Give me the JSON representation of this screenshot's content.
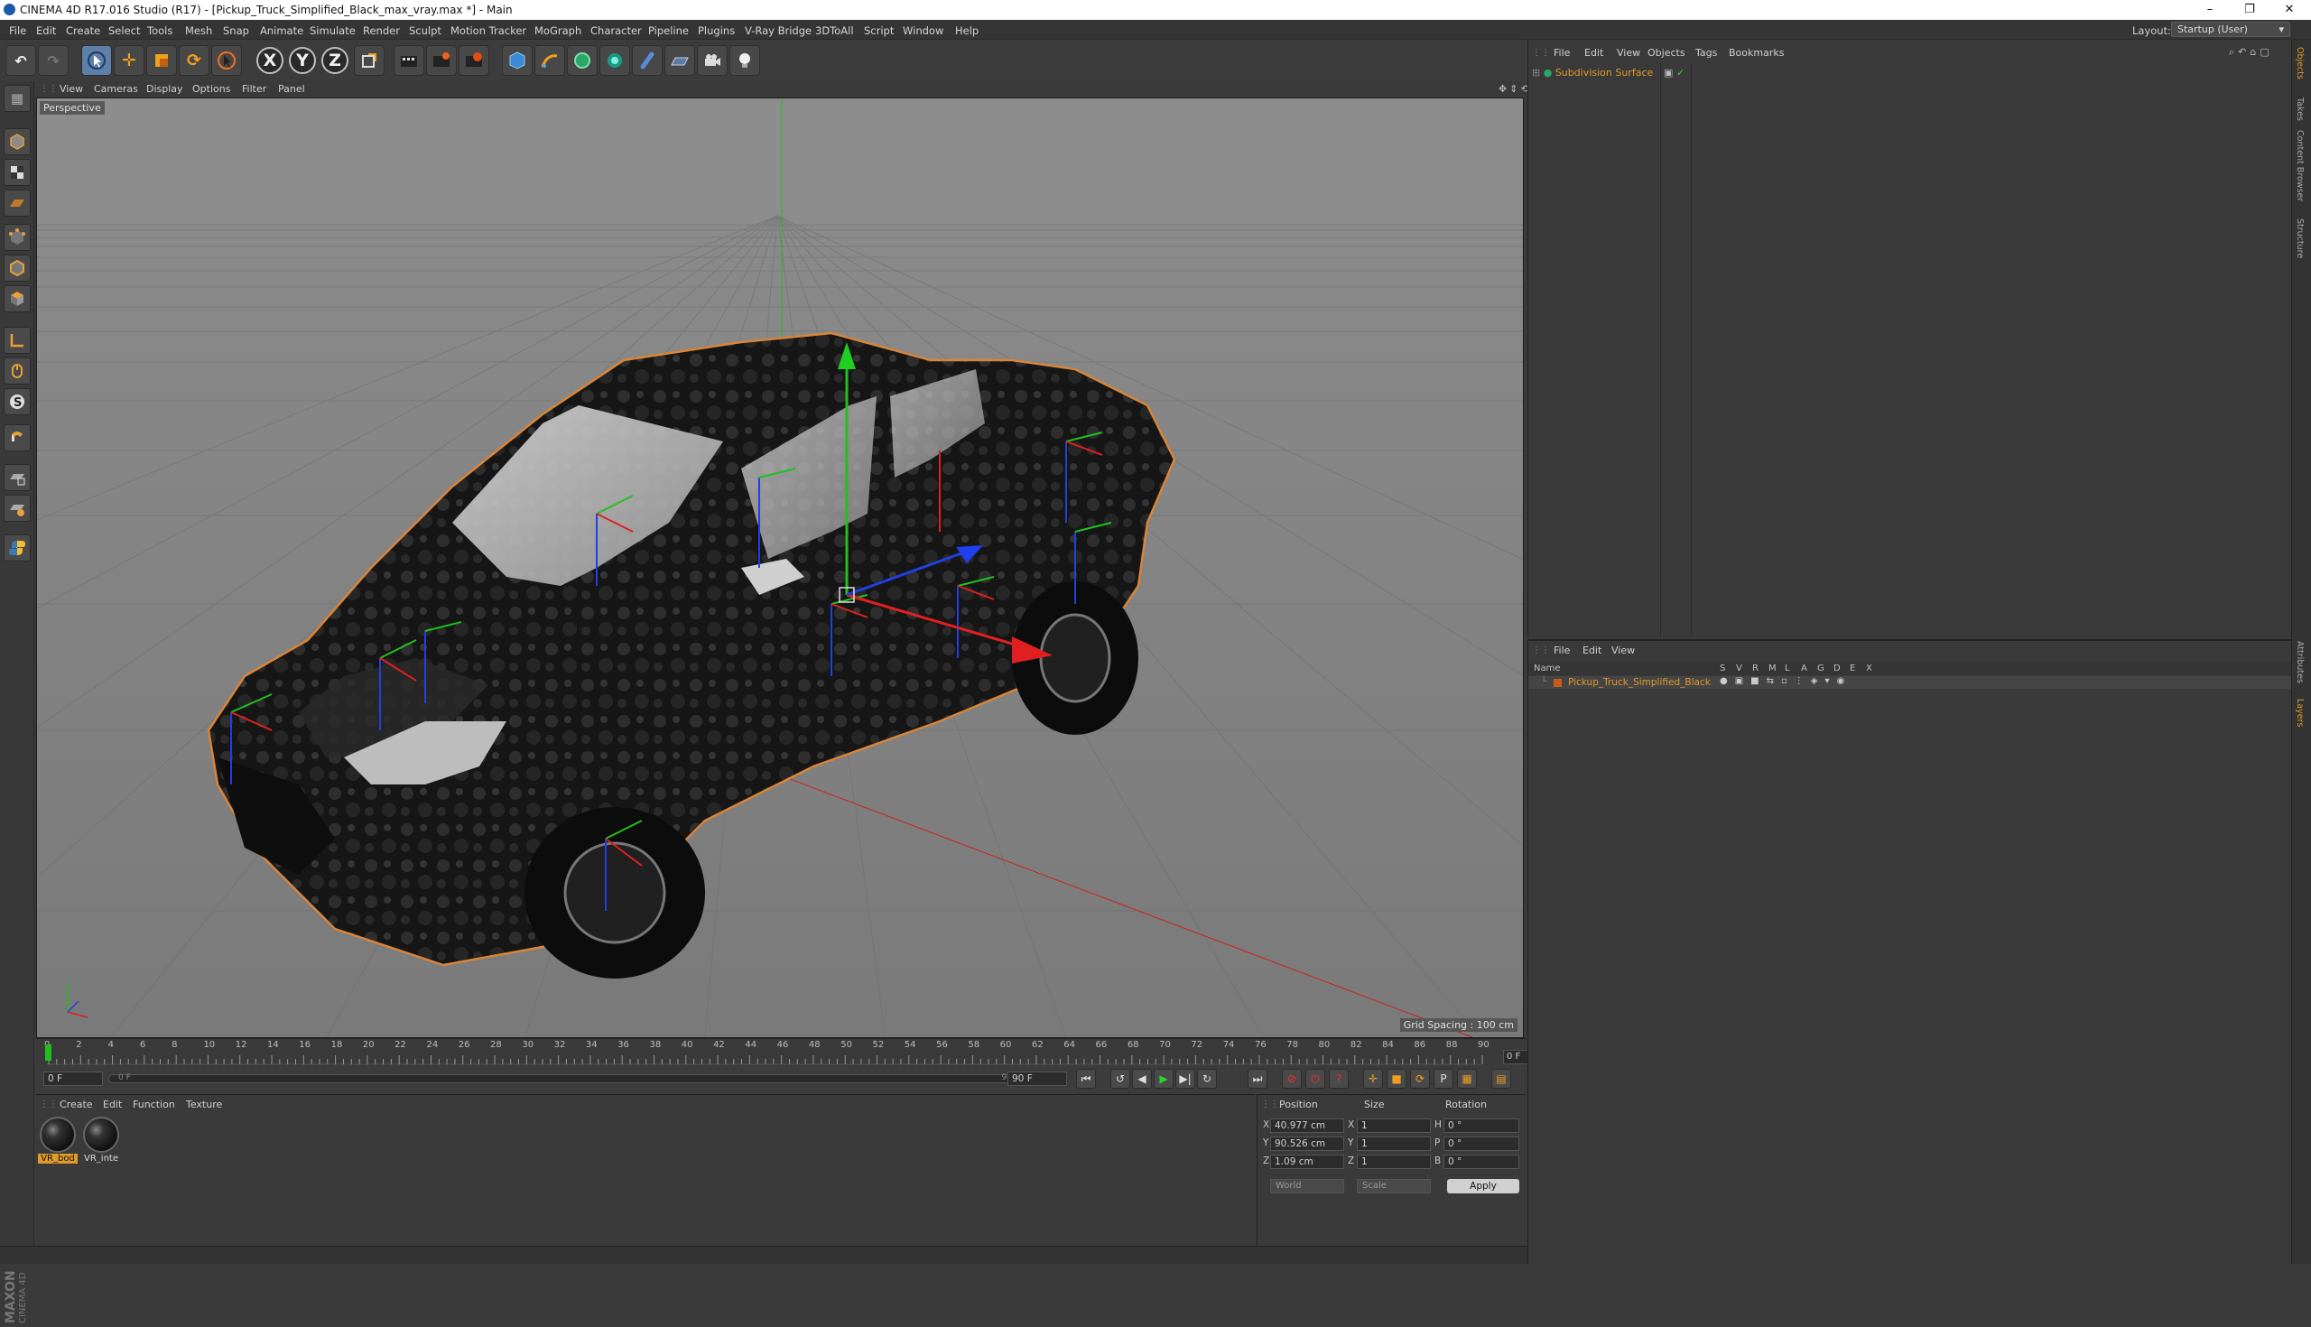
{
  "window": {
    "title": "CINEMA 4D R17.016 Studio (R17) - [Pickup_Truck_Simplified_Black_max_vray.max *] - Main",
    "controls": [
      "–",
      "❐",
      "✕"
    ]
  },
  "menubar": {
    "items": [
      "File",
      "Edit",
      "Create",
      "Select",
      "Tools",
      "Mesh",
      "Snap",
      "Animate",
      "Simulate",
      "Render",
      "Sculpt",
      "Motion Tracker",
      "MoGraph",
      "Character",
      "Pipeline",
      "Plugins",
      "V-Ray Bridge",
      "3DToAll",
      "Script",
      "Window",
      "Help"
    ],
    "layout_label": "Layout:",
    "layout_value": "Startup (User)"
  },
  "toolbar": {
    "axis_x": "X",
    "axis_y": "Y",
    "axis_z": "Z"
  },
  "viewport": {
    "menu": [
      "View",
      "Cameras",
      "Display",
      "Options",
      "Filter",
      "Panel"
    ],
    "camera_label": "Perspective",
    "grid_spacing": "Grid Spacing : 100 cm"
  },
  "timeline": {
    "ticks": [
      "0",
      "2",
      "4",
      "6",
      "8",
      "10",
      "12",
      "14",
      "16",
      "18",
      "20",
      "22",
      "24",
      "26",
      "28",
      "30",
      "32",
      "34",
      "36",
      "38",
      "40",
      "42",
      "44",
      "46",
      "48",
      "50",
      "52",
      "54",
      "56",
      "58",
      "60",
      "62",
      "64",
      "66",
      "68",
      "70",
      "72",
      "74",
      "76",
      "78",
      "80",
      "82",
      "84",
      "86",
      "88",
      "90"
    ],
    "current_frame": "0 F",
    "start_frame": "0 F",
    "range_start": "0 F",
    "range_end": "90 F",
    "end_frame": "90 F"
  },
  "materials": {
    "menu": [
      "Create",
      "Edit",
      "Function",
      "Texture"
    ],
    "items": [
      {
        "name": "VR_bod",
        "selected": true
      },
      {
        "name": "VR_inte",
        "selected": false
      }
    ]
  },
  "coordinates": {
    "headers": {
      "position": "Position",
      "size": "Size",
      "rotation": "Rotation"
    },
    "rows": [
      {
        "axis": "X",
        "pos": "40.977 cm",
        "size_axis": "X",
        "size": "1",
        "rot_axis": "H",
        "rot": "0 °"
      },
      {
        "axis": "Y",
        "pos": "90.526 cm",
        "size_axis": "Y",
        "size": "1",
        "rot_axis": "P",
        "rot": "0 °"
      },
      {
        "axis": "Z",
        "pos": "1.09 cm",
        "size_axis": "Z",
        "size": "1",
        "rot_axis": "B",
        "rot": "0 °"
      }
    ],
    "mode_world": "World",
    "mode_scale": "Scale",
    "apply": "Apply"
  },
  "branding": {
    "maxon": "MAXON",
    "product": "CINEMA 4D"
  },
  "object_manager": {
    "menu": [
      "File",
      "Edit",
      "View",
      "Objects",
      "Tags",
      "Bookmarks"
    ],
    "object_name": "Subdivision Surface"
  },
  "layer_manager": {
    "menu": [
      "File",
      "Edit",
      "View"
    ],
    "columns": [
      "Name",
      "S",
      "V",
      "R",
      "M",
      "L",
      "A",
      "G",
      "D",
      "E",
      "X"
    ],
    "layer_name": "Pickup_Truck_Simplified_Black"
  },
  "right_tabs": [
    "Objects",
    "Takes",
    "Content Browser",
    "Structure",
    "Attributes",
    "Layers"
  ],
  "colors": {
    "accent_orange": "#e09a2a",
    "axis_x": "#e02020",
    "axis_y": "#20c020",
    "axis_z": "#2040e0",
    "selection_outline": "#d9853a"
  }
}
